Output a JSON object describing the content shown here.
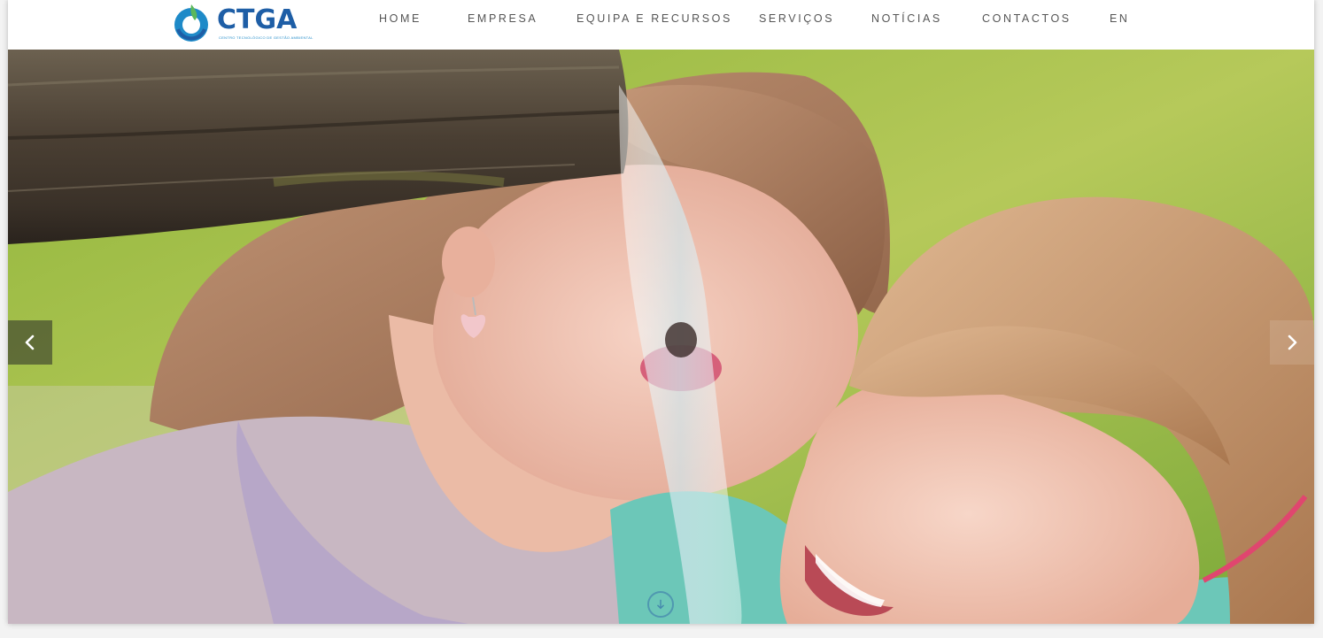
{
  "header": {
    "logo": {
      "text": "CTGA",
      "subtitle": "CENTRO TECNOLÓGICO DE GESTÃO AMBIENTAL",
      "colors": {
        "primary": "#1e5ea6",
        "accent": "#1e8ac8",
        "leaf": "#5bb85c"
      }
    },
    "nav": [
      {
        "label": "HOME"
      },
      {
        "label": "EMPRESA"
      },
      {
        "label": "EQUIPA E RECURSOS"
      },
      {
        "label": "SERVIÇOS"
      },
      {
        "label": "NOTÍCIAS"
      },
      {
        "label": "CONTACTOS"
      },
      {
        "label": "EN"
      }
    ]
  },
  "slider": {
    "image_description_icon": "photo-children-drinking-water",
    "prev_icon": "chevron-left-icon",
    "next_icon": "chevron-right-icon",
    "scroll_icon": "arrow-down-icon"
  }
}
